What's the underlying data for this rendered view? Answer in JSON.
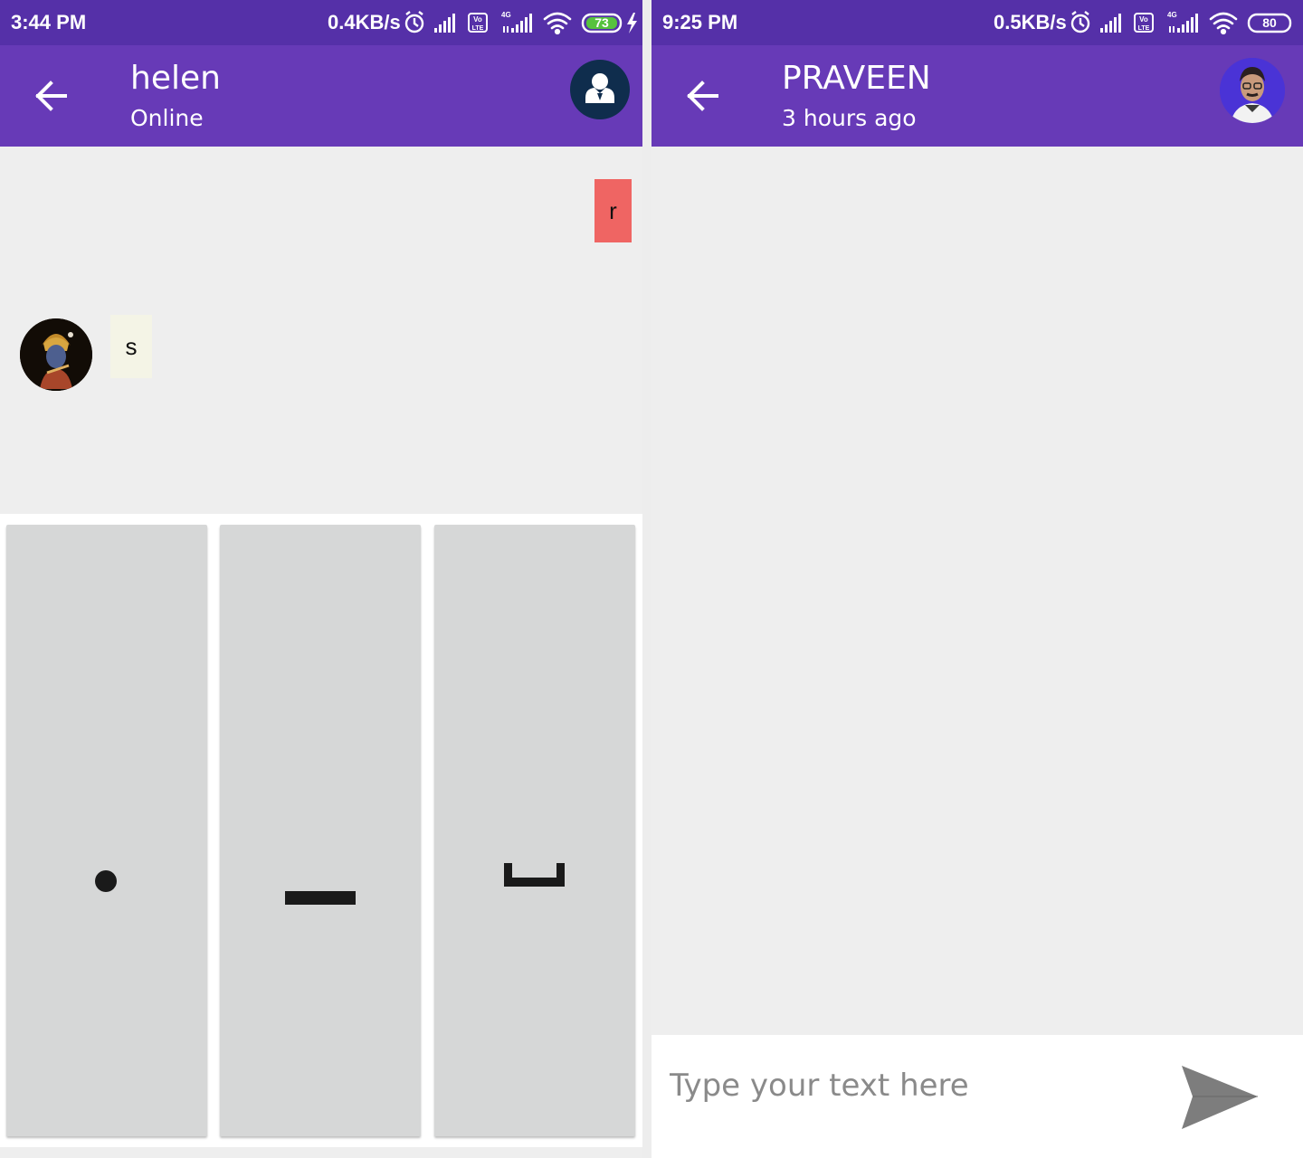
{
  "left_screen": {
    "status_bar": {
      "time": "3:44 PM",
      "net_speed": "0.4KB/s",
      "battery": "73",
      "charging": true
    },
    "app_bar": {
      "title": "helen",
      "subtitle": "Online"
    },
    "messages": [
      {
        "side": "sent",
        "text": "r",
        "color": "#ef6563"
      },
      {
        "side": "received",
        "text": "s",
        "color": "#f4f4e6"
      }
    ],
    "keys": [
      {
        "label": "dot",
        "symbol": "dot-icon"
      },
      {
        "label": "dash",
        "symbol": "dash-icon"
      },
      {
        "label": "space",
        "symbol": "space-icon"
      }
    ]
  },
  "right_screen": {
    "status_bar": {
      "time": "9:25 PM",
      "net_speed": "0.5KB/s",
      "battery": "80",
      "charging": false
    },
    "app_bar": {
      "title": "PRAVEEN",
      "subtitle": "3 hours ago"
    },
    "composer": {
      "placeholder": "Type your text here",
      "value": ""
    }
  },
  "colors": {
    "status_bar": "#5530a8",
    "app_bar": "#673ab7",
    "chat_background": "#eeeeee",
    "key_background": "#d6d7d7"
  }
}
